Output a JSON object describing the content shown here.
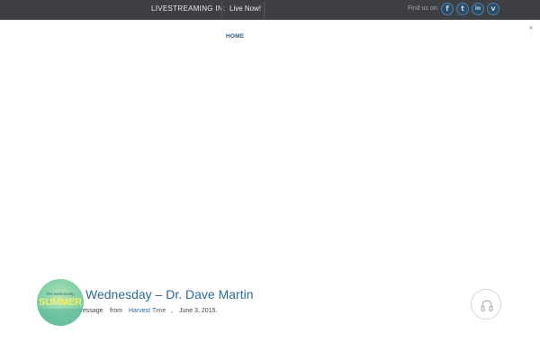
{
  "topbar": {
    "livestream_label": "LIVESTREAMING IN:",
    "live_now": "Live Now!",
    "find_us": "Find us on:",
    "social_icons": [
      "facebook-icon",
      "twitter-icon",
      "linkedin-icon",
      "vimeo-icon"
    ],
    "social_glyphs": [
      "f",
      "t",
      "in",
      "v"
    ]
  },
  "close_glyph": "×",
  "nav": {
    "home": "HOME"
  },
  "sermon": {
    "thumbnail_small_text": "first wednesday",
    "thumbnail_big_text": "SUMMER",
    "title": "Wednesday – Dr. Dave Martin",
    "type_fragment": "essage",
    "from_label": "from",
    "series_link": "Harvest Time",
    "separator": ",",
    "date": "June 3, 2015."
  },
  "colors": {
    "topbar_bg": "#3d3f42",
    "accent_blue": "#2f6a95",
    "social_border": "#4a7fb0"
  }
}
